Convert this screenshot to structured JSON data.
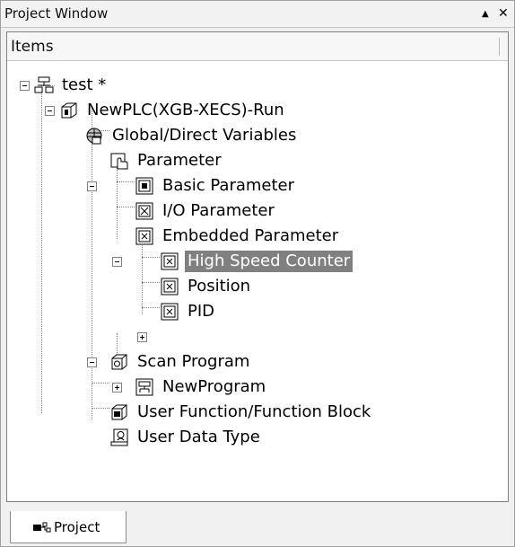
{
  "window": {
    "title": "Project Window",
    "pin_glyph": "▲",
    "close_glyph": "✕"
  },
  "header": {
    "label": "Items"
  },
  "tree": {
    "root": {
      "label": "test *"
    },
    "plc": {
      "label": "NewPLC(XGB-XECS)-Run"
    },
    "global_vars": {
      "label": "Global/Direct Variables"
    },
    "parameter": {
      "label": "Parameter"
    },
    "basic_param": {
      "label": "Basic Parameter"
    },
    "io_param": {
      "label": "I/O Parameter"
    },
    "embedded_param": {
      "label": "Embedded Parameter"
    },
    "high_speed_counter": {
      "label": "High Speed Counter"
    },
    "position": {
      "label": "Position"
    },
    "pid": {
      "label": "PID"
    },
    "scan_program": {
      "label": "Scan Program"
    },
    "new_program": {
      "label": "NewProgram"
    },
    "user_function": {
      "label": "User Function/Function Block"
    },
    "user_data_type": {
      "label": "User Data Type"
    }
  },
  "tabs": {
    "project": "Project"
  },
  "colors": {
    "selected_bg": "#808080",
    "selected_fg": "#ffffff"
  }
}
